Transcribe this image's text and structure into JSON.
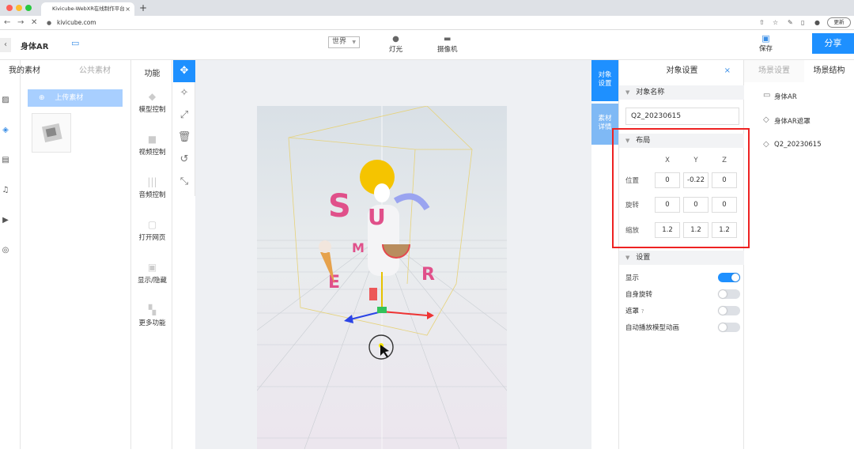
{
  "browser": {
    "tab_title": "Kivicube-WebXR在线制作平台",
    "new_tab": "+",
    "url": "kivicube.com",
    "update_label": "更新",
    "dots": [
      "#ff5f57",
      "#febc2e",
      "#28c840"
    ]
  },
  "header": {
    "back": "‹",
    "project_name": "身体AR",
    "world_select": "世界",
    "light_label": "灯光",
    "camera_label": "摄像机",
    "save_label": "保存",
    "share_label": "分享"
  },
  "assets": {
    "tabs": [
      "我的素材",
      "公共素材"
    ],
    "upload_label": "上传素材"
  },
  "functions": {
    "title": "功能",
    "items": [
      "模型控制",
      "视频控制",
      "音频控制",
      "打开网页",
      "显示/隐藏",
      "更多功能"
    ]
  },
  "side_tabs": [
    "对象设置",
    "素材详情"
  ],
  "object_settings": {
    "title": "对象设置",
    "close": "×",
    "name_section": "对象名称",
    "object_name": "Q2_20230615",
    "layout_section": "布局",
    "axes": [
      "X",
      "Y",
      "Z"
    ],
    "rows": [
      {
        "label": "位置",
        "values": [
          "0",
          "-0.22",
          "0"
        ]
      },
      {
        "label": "旋转",
        "values": [
          "0",
          "0",
          "0"
        ]
      },
      {
        "label": "缩放",
        "values": [
          "1.2",
          "1.2",
          "1.2"
        ]
      }
    ],
    "settings_section": "设置",
    "toggles": [
      {
        "label": "显示",
        "on": true
      },
      {
        "label": "自身旋转",
        "on": false
      },
      {
        "label": "遮罩",
        "on": false
      },
      {
        "label": "自动播放模型动画",
        "on": false
      }
    ]
  },
  "scene": {
    "tabs": [
      "场景设置",
      "场景结构"
    ],
    "items": [
      "身体AR",
      "身体AR遮罩",
      "Q2_20230615"
    ]
  },
  "colors": {
    "accent": "#1e90ff",
    "highlight": "#e22222"
  }
}
